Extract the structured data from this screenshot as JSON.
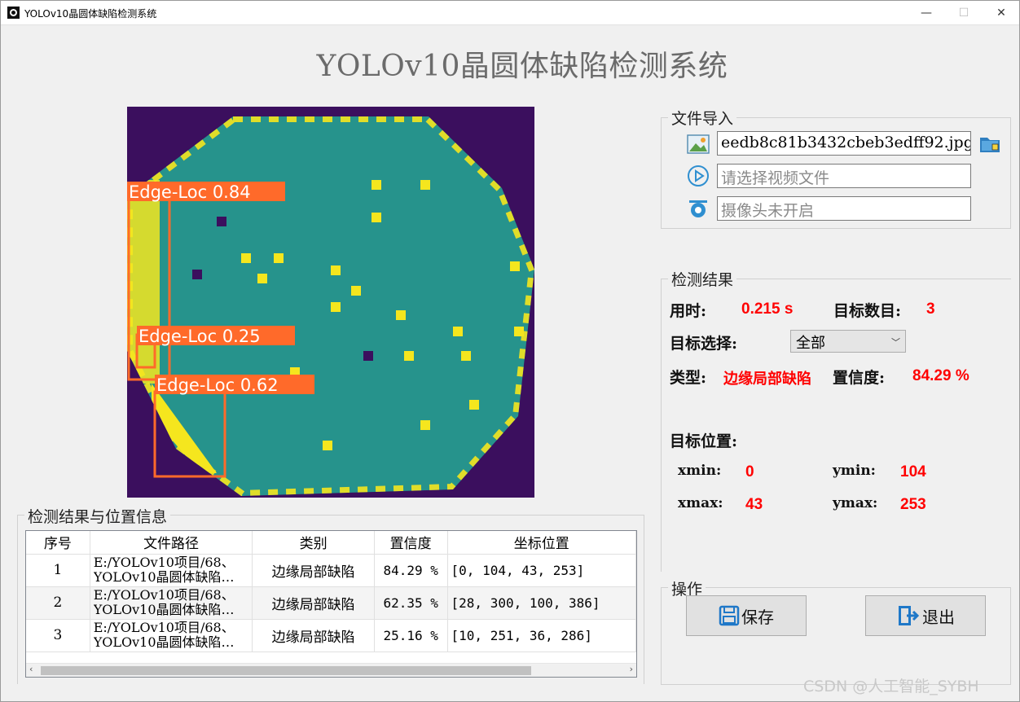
{
  "window": {
    "title": "YOLOv10晶圆体缺陷检测系统",
    "minimize_glyph": "—",
    "maximize_glyph": "☐",
    "close_glyph": "✕"
  },
  "app_title": "YOLOv10晶圆体缺陷检测系统",
  "detections_overlay": [
    {
      "label": "Edge-Loc 0.84",
      "color": "#ff6a2a"
    },
    {
      "label": "Edge-Loc 0.25",
      "color": "#ff6a2a"
    },
    {
      "label": "Edge-Loc 0.62",
      "color": "#ff6a2a"
    }
  ],
  "file_import": {
    "title": "文件导入",
    "image_value": "eedb8c81b3432cbeb3edff92.jpg",
    "video_placeholder": "请选择视频文件",
    "camera_placeholder": "摄像头未开启",
    "icons": [
      "image-icon",
      "folder-icon",
      "video-icon",
      "camera-icon"
    ]
  },
  "results": {
    "title": "检测结果",
    "time_label": "用时:",
    "time_value": "0.215 s",
    "count_label": "目标数目:",
    "count_value": "3",
    "select_label": "目标选择:",
    "select_value": "全部",
    "type_label": "类型:",
    "type_value": "边缘局部缺陷",
    "conf_label": "置信度:",
    "conf_value": "84.29 %",
    "position_label": "目标位置:",
    "xmin_label": "xmin:",
    "xmin_value": "0",
    "ymin_label": "ymin:",
    "ymin_value": "104",
    "xmax_label": "xmax:",
    "xmax_value": "43",
    "ymax_label": "ymax:",
    "ymax_value": "253"
  },
  "operations": {
    "title": "操作",
    "save_label": "保存",
    "exit_label": "退出"
  },
  "table": {
    "title": "检测结果与位置信息",
    "headers": [
      "序号",
      "文件路径",
      "类别",
      "置信度",
      "坐标位置"
    ],
    "rows": [
      {
        "idx": "1",
        "path1": "E:/YOLOv10项目/68、",
        "path2": "YOLOv10晶圆体缺陷…",
        "cls": "边缘局部缺陷",
        "conf": "84.29 %",
        "coord": "[0, 104, 43, 253]"
      },
      {
        "idx": "2",
        "path1": "E:/YOLOv10项目/68、",
        "path2": "YOLOv10晶圆体缺陷…",
        "cls": "边缘局部缺陷",
        "conf": "62.35 %",
        "coord": "[28, 300, 100, 386]"
      },
      {
        "idx": "3",
        "path1": "E:/YOLOv10项目/68、",
        "path2": "YOLOv10晶圆体缺陷…",
        "cls": "边缘局部缺陷",
        "conf": "25.16 %",
        "coord": "[10, 251, 36, 286]"
      }
    ]
  },
  "watermark": "CSDN @人工智能_SYBH",
  "colors": {
    "accent_red": "#ff0000",
    "box_orange": "#ff6a2a",
    "wafer_bg": "#3b0f5e",
    "wafer_teal": "#26938c",
    "wafer_yellow": "#f5e61e"
  }
}
